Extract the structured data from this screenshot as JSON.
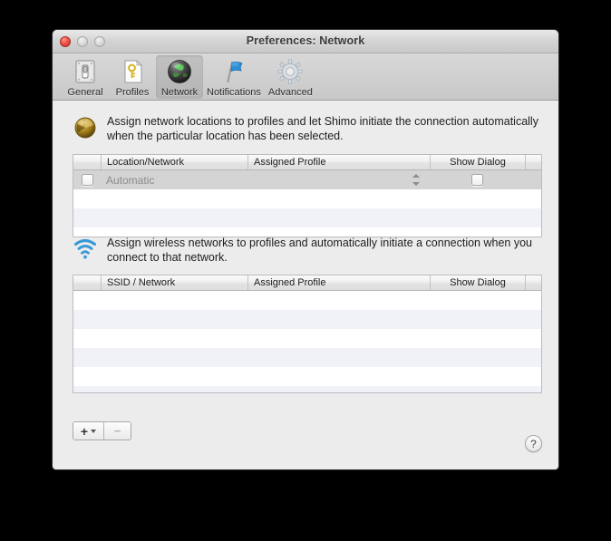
{
  "window": {
    "title": "Preferences: Network",
    "traffic_lights": [
      {
        "name": "close",
        "color": "#f2554a"
      },
      {
        "name": "minimize",
        "color": "#d8d8d8"
      },
      {
        "name": "zoom",
        "color": "#d8d8d8"
      }
    ]
  },
  "toolbar": {
    "items": [
      {
        "label": "General",
        "icon": "light-switch-icon",
        "selected": false
      },
      {
        "label": "Profiles",
        "icon": "document-key-icon",
        "selected": false
      },
      {
        "label": "Network",
        "icon": "globe-icon",
        "selected": true
      },
      {
        "label": "Notifications",
        "icon": "flag-icon",
        "selected": false
      },
      {
        "label": "Advanced",
        "icon": "gear-icon",
        "selected": false
      }
    ]
  },
  "sections": [
    {
      "id": "locations",
      "icon": "gold-globe-icon",
      "description": "Assign network locations to profiles and let Shimo initiate the connection automatically when the particular location has been selected.",
      "columns": [
        "",
        "Location/Network",
        "Assigned Profile",
        "Show Dialog",
        ""
      ],
      "rows": [
        {
          "checked": false,
          "name": "Automatic",
          "assigned_profile": "",
          "show_dialog": false,
          "selected": true,
          "has_stepper": true
        }
      ],
      "empty_rows": 3
    },
    {
      "id": "wireless",
      "icon": "wifi-icon",
      "description": "Assign wireless networks to profiles and automatically initiate a connection when you connect to that network.",
      "columns": [
        "",
        "SSID / Network",
        "Assigned Profile",
        "Show Dialog",
        ""
      ],
      "rows": [],
      "empty_rows": 6
    }
  ],
  "footer": {
    "add_label": "+",
    "add_menu_indicator": "chevron-down",
    "remove_label": "−",
    "remove_disabled": true,
    "help_label": "?"
  },
  "colors": {
    "window_bg": "#ececec",
    "toolbar_bg": "#d0d0d0",
    "table_row_alt": "#f0f2f7",
    "table_row_selected": "#d4d4d4",
    "wifi_blue": "#3a9ad9",
    "accent_gold": "#b8922e"
  }
}
